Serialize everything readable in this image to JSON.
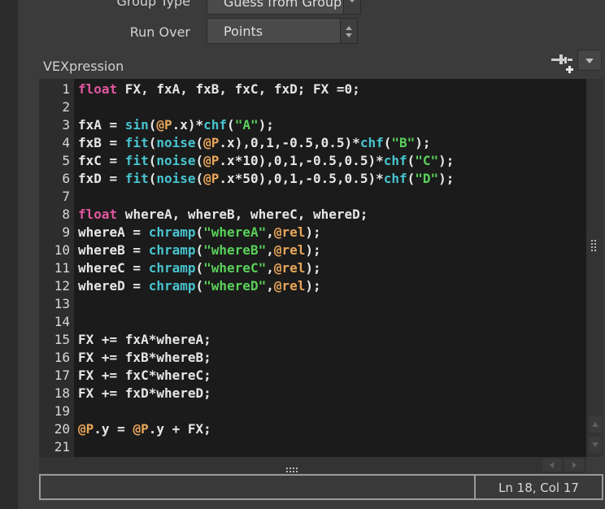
{
  "params": {
    "group_type": {
      "label": "Group Type",
      "value": "Guess from Group"
    },
    "run_over": {
      "label": "Run Over",
      "value": "Points"
    }
  },
  "section": {
    "label": "VEXpression"
  },
  "editor": {
    "line_numbers": [
      "1",
      "2",
      "3",
      "4",
      "5",
      "6",
      "7",
      "8",
      "9",
      "10",
      "11",
      "12",
      "13",
      "14",
      "15",
      "16",
      "17",
      "18",
      "19",
      "20",
      "21"
    ],
    "lines": [
      "float FX, fxA, fxB, fxC, fxD; FX =0;",
      "",
      "fxA = sin(@P.x)*chf(\"A\");",
      "fxB = fit(noise(@P.x),0,1,-0.5,0.5)*chf(\"B\");",
      "fxC = fit(noise(@P.x*10),0,1,-0.5,0.5)*chf(\"C\");",
      "fxD = fit(noise(@P.x*50),0,1,-0.5,0.5)*chf(\"D\");",
      "",
      "float whereA, whereB, whereC, whereD;",
      "whereA = chramp(\"whereA\",@rel);",
      "whereB = chramp(\"whereB\",@rel);",
      "whereC = chramp(\"whereC\",@rel);",
      "whereD = chramp(\"whereD\",@rel);",
      "",
      "",
      "FX += fxA*whereA;",
      "FX += fxB*whereB;",
      "FX += fxC*whereC;",
      "FX += fxD*whereD;",
      "",
      "@P.y = @P.y + FX;",
      ""
    ]
  },
  "status": {
    "cursor_position": "Ln 18, Col 17"
  },
  "colors": {
    "keyword": "#e0579f",
    "function": "#47c4cf",
    "attribute": "#e7a65a",
    "string": "#59d05a"
  },
  "icons": [
    "chevron-down-icon",
    "up-down-arrows-icon",
    "add-parameter-icon",
    "grip-icon"
  ]
}
